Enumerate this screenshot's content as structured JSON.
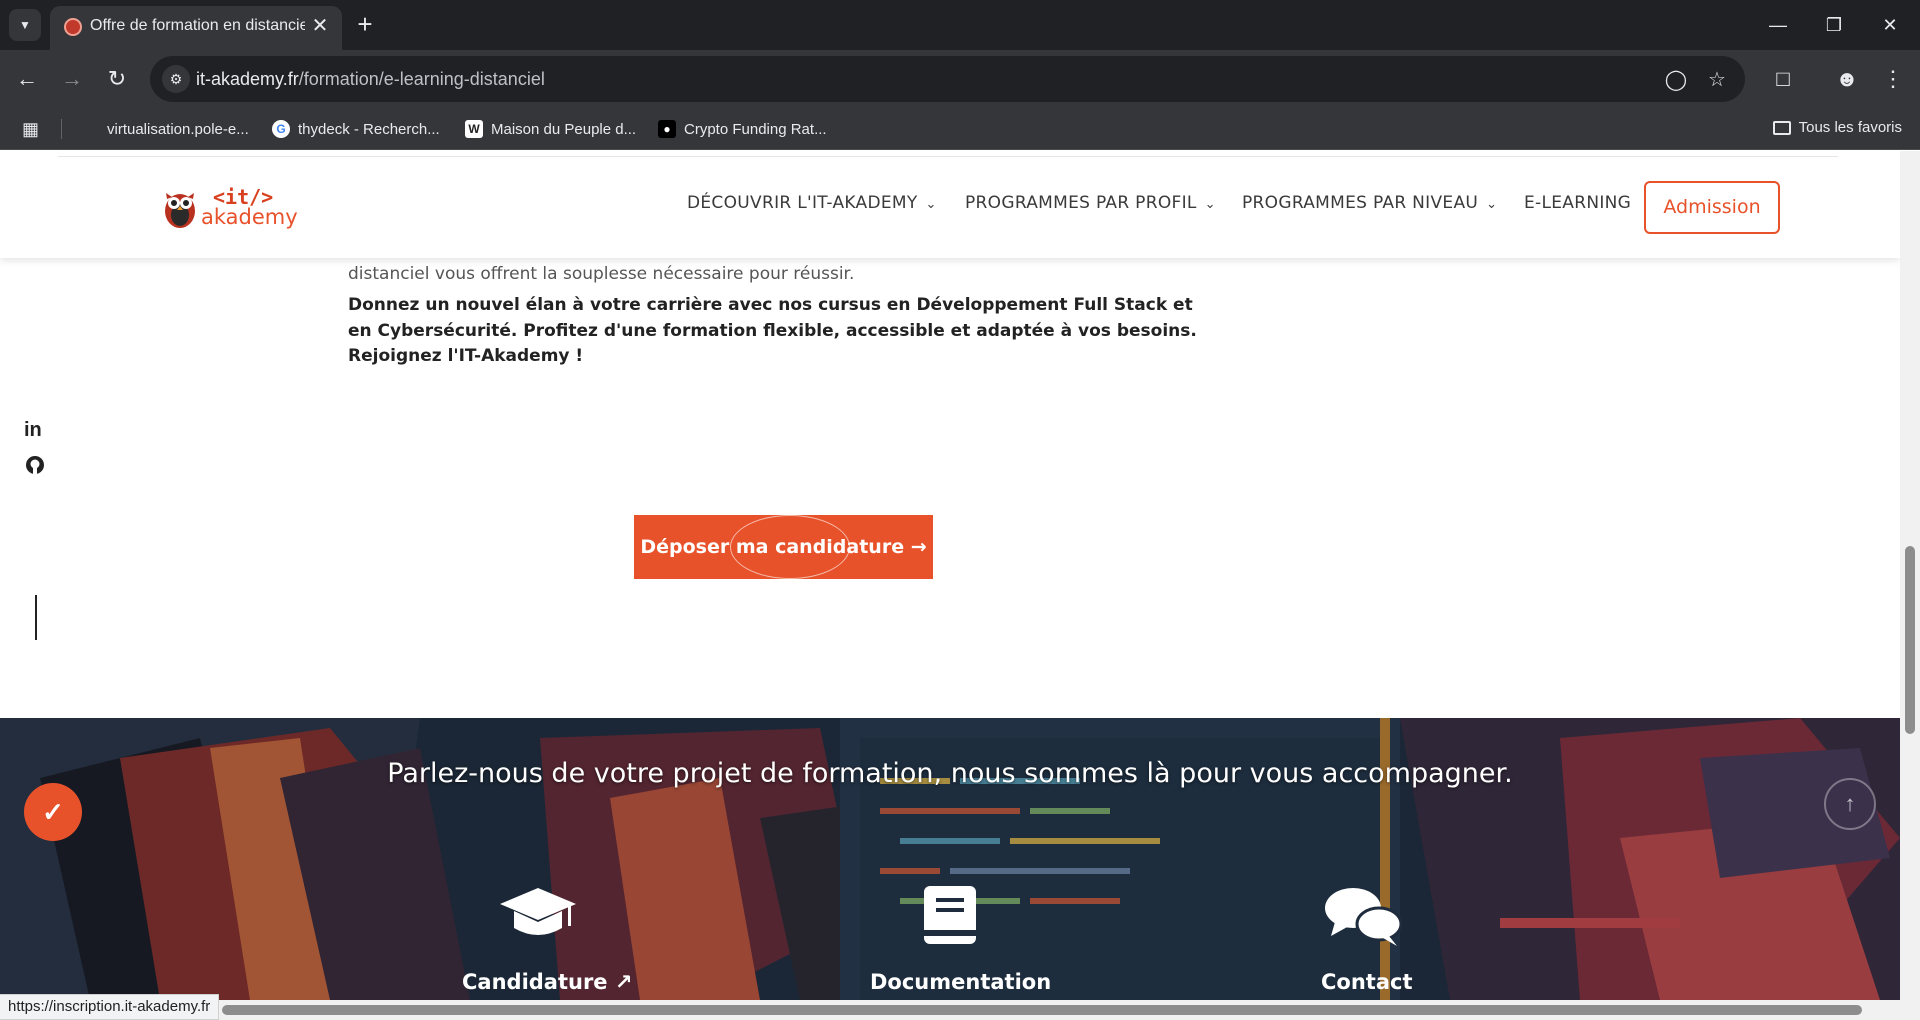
{
  "browser": {
    "tab_title": "Offre de formation en distanciel",
    "url_host": "it-akademy.fr",
    "url_path": "/formation/e-learning-distanciel",
    "bookmarks": [
      {
        "label": "virtualisation.pole-e..."
      },
      {
        "label": "thydeck - Recherch..."
      },
      {
        "label": "Maison du Peuple d..."
      },
      {
        "label": "Crypto Funding Rat..."
      }
    ],
    "all_bookmarks": "Tous les favoris",
    "status_url": "https://inscription.it-akademy.fr"
  },
  "header": {
    "logo_it": "<it/>",
    "logo_akademy": "akademy",
    "menu": [
      {
        "label": "DÉCOUVRIR L'IT-AKADEMY"
      },
      {
        "label": "PROGRAMMES PAR PROFIL"
      },
      {
        "label": "PROGRAMMES PAR NIVEAU"
      },
      {
        "label": "E-LEARNING"
      }
    ],
    "admission": "Admission"
  },
  "content": {
    "paragraph": "nous avons conçu nos formations pour s'adapter à vous, et non l'inverse. Que vous ayez un emploi du temps chargé, des responsabilités familiales, ou toute autre contrainte, nos formations en distanciel vous offrent la souplesse nécessaire pour réussir.",
    "bold_paragraph": "Donnez un nouvel élan à votre carrière avec nos cursus en Développement Full Stack et en Cybersécurité. Profitez d'une formation flexible, accessible et adaptée à vos besoins. Rejoignez l'IT-Akademy !",
    "cta_label": "Déposer ma candidature"
  },
  "social": {
    "linkedin": "in"
  },
  "footer": {
    "title": "Parlez-nous de votre projet de formation, nous sommes là pour vous accompagner.",
    "items": [
      {
        "label": "Candidature",
        "icon": "graduation-cap-icon"
      },
      {
        "label": "Documentation",
        "icon": "book-icon"
      },
      {
        "label": "Contact",
        "icon": "chat-bubbles-icon"
      }
    ]
  },
  "colors": {
    "accent": "#e8522a",
    "footer_bg": "#1d2a3a"
  }
}
